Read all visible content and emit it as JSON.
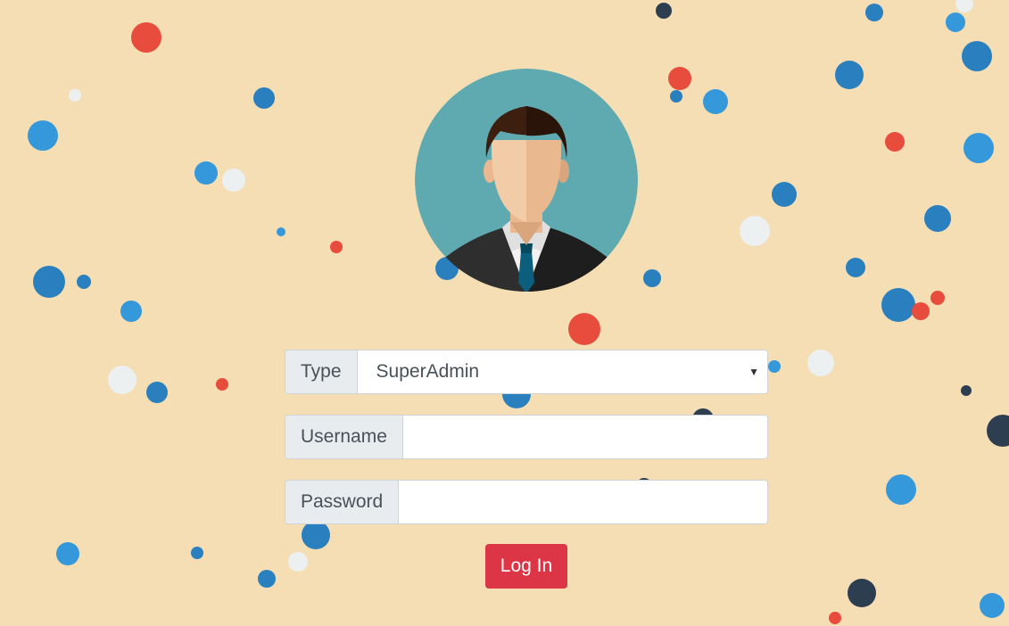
{
  "login_form": {
    "type_label": "Type",
    "type_selected": "SuperAdmin",
    "username_label": "Username",
    "username_value": "",
    "password_label": "Password",
    "password_value": "",
    "submit_label": "Log In"
  },
  "avatar": {
    "icon": "user-avatar-icon"
  },
  "colors": {
    "background": "#f5deb3",
    "button": "#dc3545",
    "bubble_red": "#e74c3c",
    "bubble_blue": "#3498db",
    "bubble_dark_blue": "#2a7fbf",
    "bubble_navy": "#2c3e50",
    "bubble_white": "#ecf0f1"
  }
}
